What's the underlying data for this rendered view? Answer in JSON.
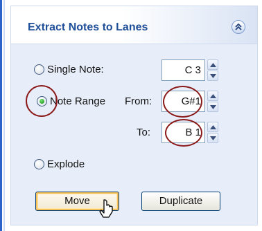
{
  "panel": {
    "title": "Extract Notes to Lanes",
    "collapse_icon": "double-chevron-up-icon"
  },
  "options": {
    "single_note": {
      "label": "Single Note:",
      "value": "C 3",
      "selected": false
    },
    "note_range": {
      "label": "Note Range",
      "from_label": "From:",
      "from_value": "G#1",
      "to_label": "To:",
      "to_value": "B 1",
      "selected": true
    },
    "explode": {
      "label": "Explode",
      "selected": false
    }
  },
  "buttons": {
    "move": "Move",
    "duplicate": "Duplicate"
  },
  "colors": {
    "title": "#1f4e99",
    "annotation_ring": "#8b1a1a",
    "radio_selected": "#1c9a1c"
  }
}
